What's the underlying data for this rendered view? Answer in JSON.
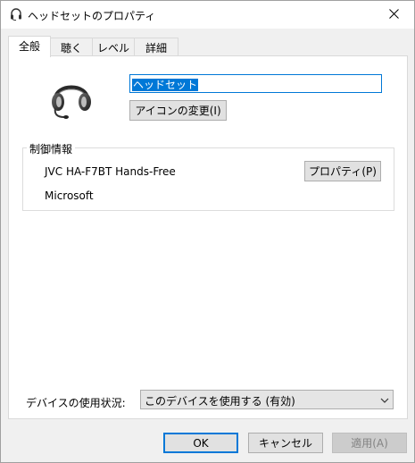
{
  "window": {
    "title": "ヘッドセットのプロパティ"
  },
  "tabs": [
    {
      "label": "全般",
      "active": true
    },
    {
      "label": "聴く",
      "active": false
    },
    {
      "label": "レベル",
      "active": false
    },
    {
      "label": "詳細",
      "active": false
    }
  ],
  "general": {
    "device_name": "ヘッドセット",
    "change_icon_label": "アイコンの変更(I)",
    "controller_group_label": "制御情報",
    "controller_name": "JVC HA-F7BT Hands-Free",
    "manufacturer": "Microsoft",
    "properties_button_label": "プロパティ(P)",
    "usage_label": "デバイスの使用状況:",
    "usage_selected": "このデバイスを使用する (有効)"
  },
  "footer": {
    "ok_label": "OK",
    "cancel_label": "キャンセル",
    "apply_label": "適用(A)"
  },
  "colors": {
    "accent": "#0078d7",
    "dialog_bg": "#f0f0f0",
    "panel_bg": "#ffffff"
  },
  "icons": [
    "headset-icon",
    "close-icon",
    "chevron-down-icon"
  ]
}
